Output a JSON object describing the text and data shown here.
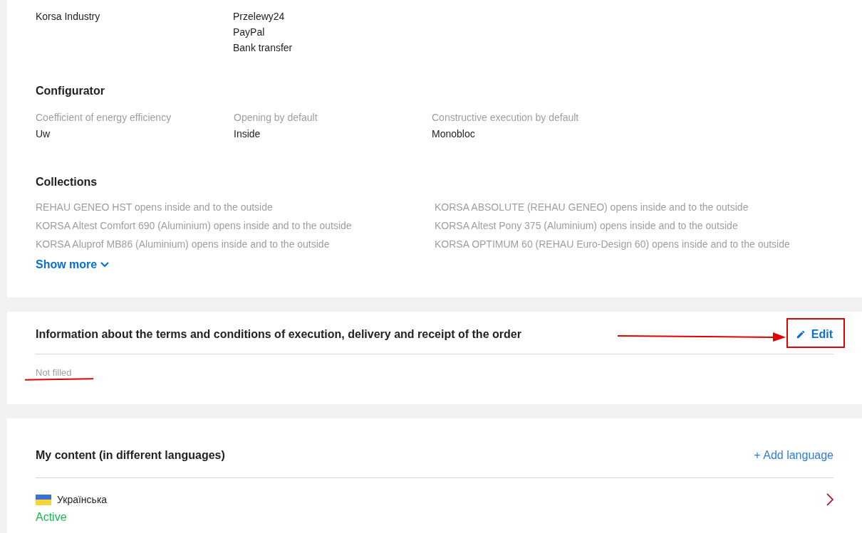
{
  "company": {
    "firm": "Korsa Industry",
    "payment_methods": [
      "Przelewy24",
      "PayPal",
      "Bank transfer"
    ]
  },
  "configurator": {
    "title": "Configurator",
    "fields": [
      {
        "label": "Coefficient of energy efficiency",
        "value": "Uw"
      },
      {
        "label": "Opening by default",
        "value": "Inside"
      },
      {
        "label": "Constructive execution by default",
        "value": "Monobloc"
      }
    ]
  },
  "collections": {
    "title": "Collections",
    "items": [
      "REHAU GENEO HST opens inside and to the outside",
      "KORSA ABSOLUTE (REHAU GENEO) opens inside and to the outside",
      "KORSA Altest Comfort 690 (Aluminium) opens inside and to the outside",
      "KORSA Altest Pony 375 (Aluminium) opens inside and to the outside",
      "KORSA Aluprof MB86 (Aluminium) opens inside and to the outside",
      "KORSA OPTIMUM 60 (REHAU Euro-Design 60) opens inside and to the outside"
    ],
    "show_more": "Show more"
  },
  "terms": {
    "title": "Information about the terms and conditions of execution, delivery and receipt of the order",
    "edit": "Edit",
    "value": "Not filled"
  },
  "content": {
    "title": "My content (in different languages)",
    "add": "+ Add language",
    "languages": [
      {
        "name": "Українська",
        "status": "Active",
        "active": true
      }
    ]
  }
}
